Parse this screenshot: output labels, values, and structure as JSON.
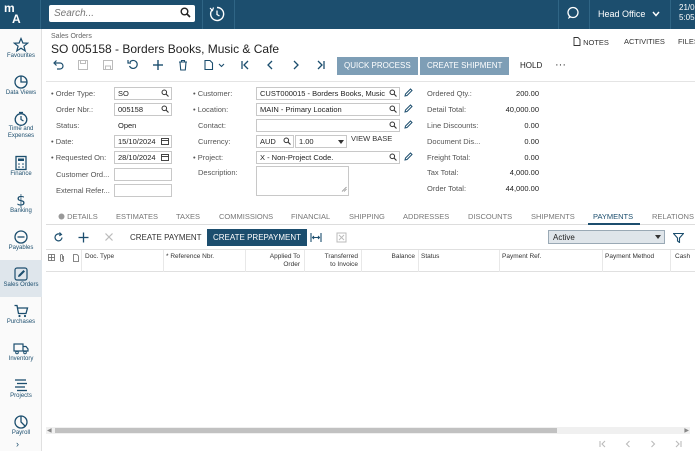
{
  "topbar": {
    "logo_line1": "m",
    "logo_line2": "A",
    "search_placeholder": "Search...",
    "company": "Head Office",
    "date_line1": "21/0",
    "date_line2": "5:05"
  },
  "nav": {
    "items": [
      {
        "label": "Favourites",
        "icon": "star-icon"
      },
      {
        "label": "Data Views",
        "icon": "pie-chart-icon"
      },
      {
        "label": "Time and Expenses",
        "icon": "clock-icon"
      },
      {
        "label": "Finance",
        "icon": "calculator-icon"
      },
      {
        "label": "Banking",
        "icon": "dollar-icon"
      },
      {
        "label": "Payables",
        "icon": "minus-circle-icon"
      },
      {
        "label": "Sales Orders",
        "icon": "pencil-icon",
        "active": true
      },
      {
        "label": "Purchases",
        "icon": "cart-icon"
      },
      {
        "label": "Inventory",
        "icon": "truck-icon"
      },
      {
        "label": "Projects",
        "icon": "list-icon"
      },
      {
        "label": "Payroll",
        "icon": "payroll-icon"
      }
    ],
    "expand": "›"
  },
  "header": {
    "breadcrumb": "Sales Orders",
    "title": "SO 005158 - Borders Books, Music & Cafe",
    "notes": "NOTES",
    "activities": "ACTIVITIES",
    "files": "FILES"
  },
  "toolbar": {
    "quick_process": "QUICK PROCESS",
    "create_shipment": "CREATE SHIPMENT",
    "hold": "HOLD",
    "more": "···"
  },
  "form": {
    "order_type_label": "Order Type:",
    "order_type": "SO",
    "order_nbr_label": "Order Nbr.:",
    "order_nbr": "005158",
    "status_label": "Status:",
    "status": "Open",
    "date_label": "Date:",
    "date": "15/10/2024",
    "requested_on_label": "Requested On:",
    "requested_on": "28/10/2024",
    "customer_ord_label": "Customer Ord...",
    "external_ref_label": "External Refer...",
    "customer_label": "Customer:",
    "customer": "CUST000015 - Borders Books, Music",
    "location_label": "Location:",
    "location": "MAIN - Primary Location",
    "contact_label": "Contact:",
    "currency_label": "Currency:",
    "currency": "AUD",
    "rate": "1.00",
    "view_base": "VIEW BASE",
    "project_label": "Project:",
    "project": "X - Non-Project Code.",
    "description_label": "Description:",
    "ordered_qty_label": "Ordered Qty.:",
    "ordered_qty": "200.00",
    "detail_total_label": "Detail Total:",
    "detail_total": "40,000.00",
    "line_discounts_label": "Line Discounts:",
    "line_discounts": "0.00",
    "document_dis_label": "Document Dis...",
    "document_dis": "0.00",
    "freight_total_label": "Freight Total:",
    "freight_total": "0.00",
    "tax_total_label": "Tax Total:",
    "tax_total": "4,000.00",
    "order_total_label": "Order Total:",
    "order_total": "44,000.00"
  },
  "tabs": [
    "DETAILS",
    "ESTIMATES",
    "TAXES",
    "COMMISSIONS",
    "FINANCIAL",
    "SHIPPING",
    "ADDRESSES",
    "DISCOUNTS",
    "SHIPMENTS",
    "PAYMENTS",
    "RELATIONS"
  ],
  "active_tab": "PAYMENTS",
  "payments": {
    "create_payment": "CREATE PAYMENT",
    "create_prepayment": "CREATE PREPAYMENT",
    "filter_value": "Active",
    "columns": [
      "Doc. Type",
      "Reference Nbr.",
      "Applied To Order",
      "Transferred to Invoice",
      "Balance",
      "Status",
      "Payment Ref.",
      "Payment Method",
      "Cash"
    ],
    "column_lines": [
      [
        "Doc. Type"
      ],
      [
        "Reference Nbr."
      ],
      [
        "Applied To",
        "Order"
      ],
      [
        "Transferred",
        "to Invoice"
      ],
      [
        "Balance"
      ],
      [
        "Status"
      ],
      [
        "Payment Ref."
      ],
      [
        "Payment Method"
      ],
      [
        "Cash"
      ]
    ],
    "rows": []
  },
  "colors": {
    "topbar": "#1c4e6e",
    "primary_button": "#1c4e6e",
    "toolbar_button": "#7e9eb6"
  }
}
